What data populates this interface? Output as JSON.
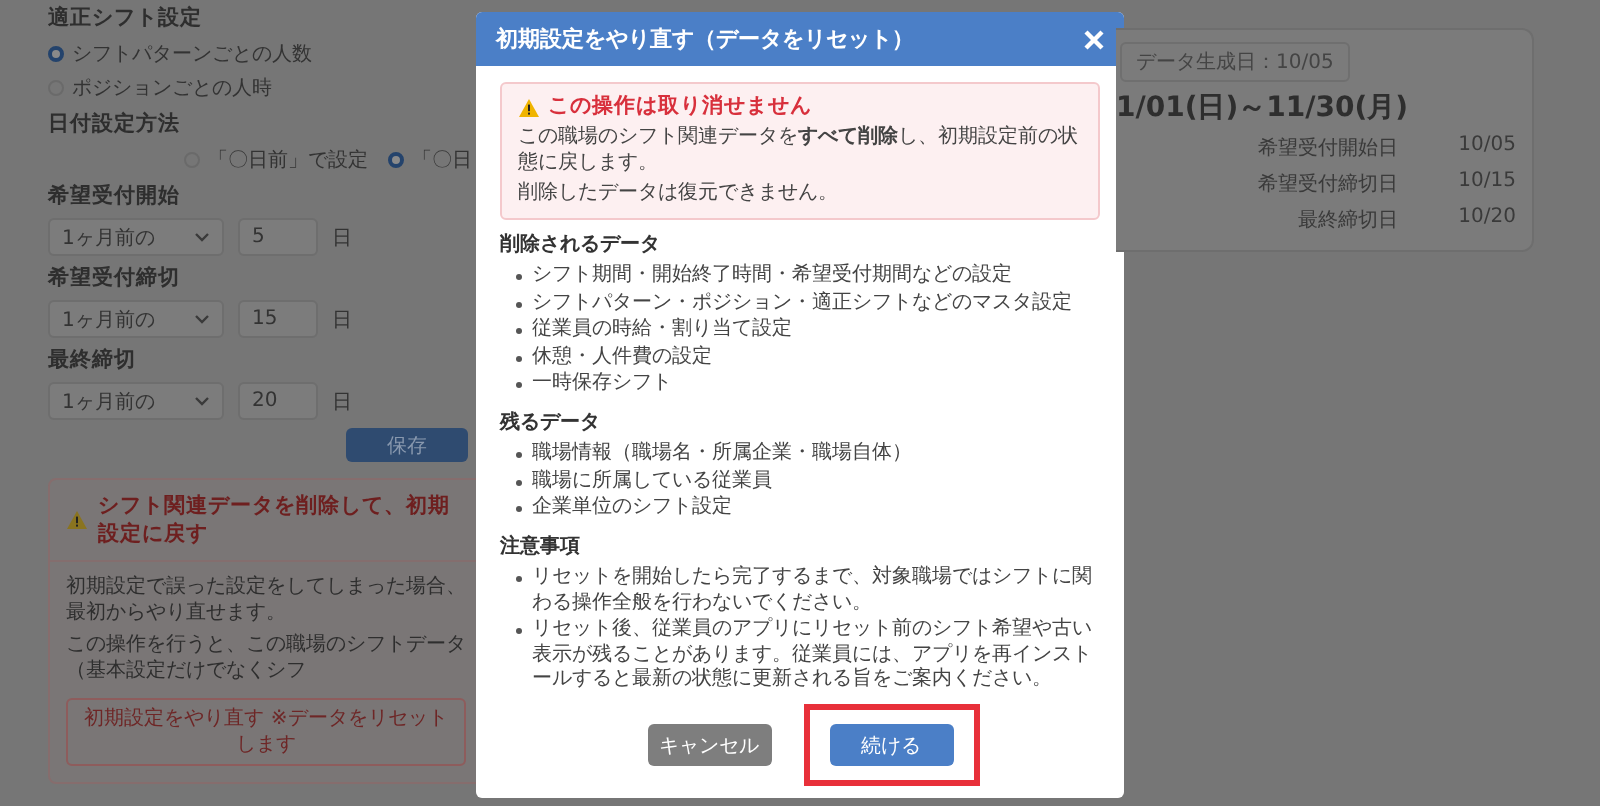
{
  "background": {
    "shift_setting": {
      "title": "適正シフト設定",
      "options": [
        {
          "label": "シフトパターンごとの人数",
          "selected": true
        },
        {
          "label": "ポジションごとの人時",
          "selected": false
        }
      ]
    },
    "date_method": {
      "title": "日付設定方法",
      "options": [
        {
          "label": "「〇日前」で設定",
          "selected": false
        },
        {
          "label": "「〇日",
          "selected": true
        }
      ]
    },
    "fields": [
      {
        "label": "希望受付開始",
        "select": "1ヶ月前の",
        "day": "5",
        "unit": "日"
      },
      {
        "label": "希望受付締切",
        "select": "1ヶ月前の",
        "day": "15",
        "unit": "日"
      },
      {
        "label": "最終締切",
        "select": "1ヶ月前の",
        "day": "20",
        "unit": "日"
      }
    ],
    "save_button": "保存",
    "reset_card": {
      "title": "シフト関連データを削除して、初期設定に戻す",
      "lines": [
        "初期設定で誤った設定をしてしまった場合、最初からやり直せます。",
        "この操作を行うと、この職場のシフトデータ（基本設定だけでなくシフ"
      ],
      "button": "初期設定をやり直す ※データをリセットします"
    },
    "summary_card": {
      "badge": "データ生成日：10/05",
      "period": "1/01(日)～11/30(月)",
      "rows": [
        {
          "label": "希望受付開始日",
          "value": "10/05"
        },
        {
          "label": "希望受付締切日",
          "value": "10/15"
        },
        {
          "label": "最終締切日",
          "value": "10/20"
        }
      ]
    }
  },
  "dialog": {
    "title": "初期設定をやり直す（データをリセット）",
    "alert": {
      "title": "この操作は取り消せません",
      "lines": [
        "この職場のシフト関連データを**すべて削除**し、初期設定前の状態に戻します。",
        "削除したデータは復元できません。"
      ]
    },
    "sections": [
      {
        "heading": "削除されるデータ",
        "items": [
          "シフト期間・開始終了時間・希望受付期間などの設定",
          "シフトパターン・ポジション・適正シフトなどのマスタ設定",
          "従業員の時給・割り当て設定",
          "休憩・人件費の設定",
          "一時保存シフト"
        ]
      },
      {
        "heading": "残るデータ",
        "items": [
          "職場情報（職場名・所属企業・職場自体）",
          "職場に所属している従業員",
          "企業単位のシフト設定"
        ]
      },
      {
        "heading": "注意事項",
        "items": [
          "リセットを開始したら完了するまで、対象職場ではシフトに関わる操作全般を行わないでください。",
          "リセット後、従業員のアプリにリセット前のシフト希望や古い表示が残ることがあります。従業員には、アプリを再インストールすると最新の状態に更新される旨をご案内ください。"
        ]
      }
    ],
    "buttons": [
      {
        "label": "キャンセル",
        "kind": "secondary",
        "highlighted": false
      },
      {
        "label": "続ける",
        "kind": "primary",
        "highlighted": true
      }
    ]
  }
}
